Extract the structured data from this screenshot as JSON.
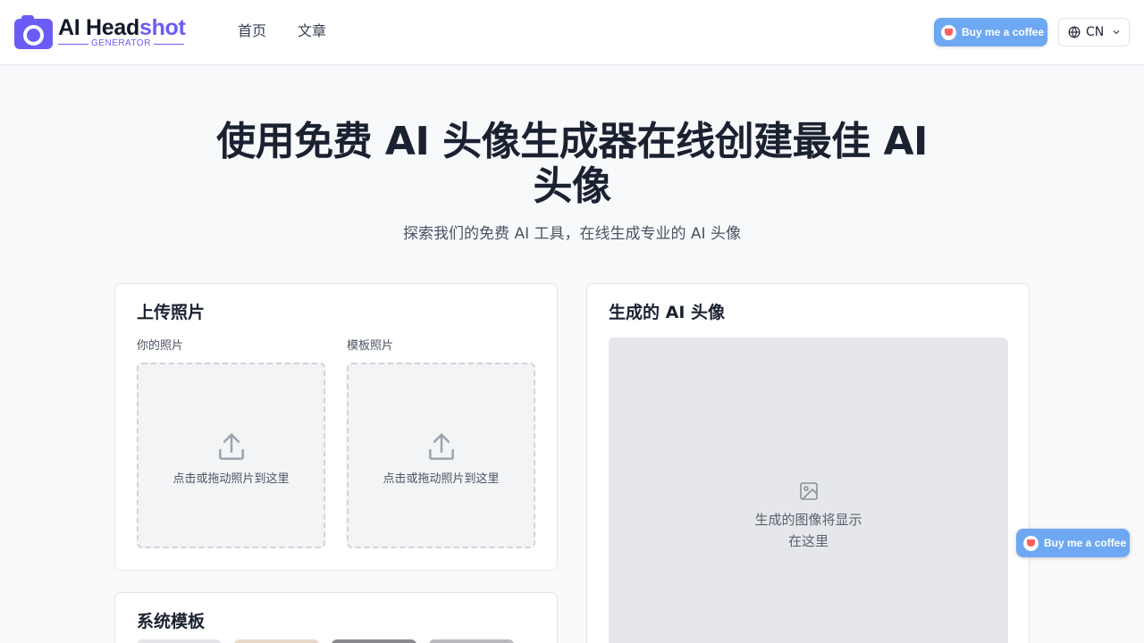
{
  "header": {
    "logo": {
      "main_a": "AI Head",
      "main_b": "shot",
      "sub": "GENERATOR"
    },
    "nav": [
      {
        "label": "首页"
      },
      {
        "label": "文章"
      }
    ],
    "coffee_label": "Buy me a coffee",
    "language": "CN"
  },
  "hero": {
    "title": "使用免费 AI 头像生成器在线创建最佳 AI 头像",
    "subtitle": "探索我们的免费 AI 工具，在线生成专业的 AI 头像"
  },
  "upload_card": {
    "title": "上传照片",
    "your_photo_label": "你的照片",
    "template_photo_label": "模板照片",
    "dropzone_text": "点击或拖动照片到这里"
  },
  "result_card": {
    "title": "生成的 AI 头像",
    "placeholder_text": "生成的图像将显示在这里"
  },
  "templates_card": {
    "title": "系统模板"
  },
  "floating_coffee_label": "Buy me a coffee",
  "colors": {
    "brand": "#6b5cf6",
    "coffee_button": "#6ea8f2",
    "page_bg": "#f8f9fb"
  },
  "icons": [
    "camera-logo-icon",
    "coffee-cup-icon",
    "globe-icon",
    "chevron-down-icon",
    "upload-icon",
    "image-icon"
  ]
}
